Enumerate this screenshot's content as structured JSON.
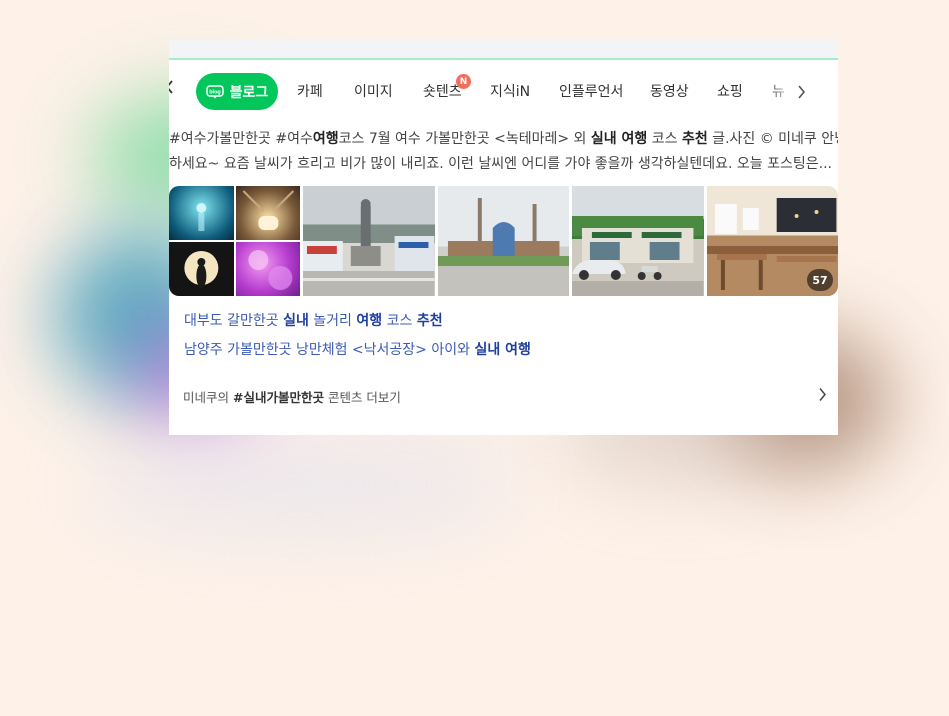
{
  "tabs": {
    "active": "블로그",
    "items": [
      "카페",
      "이미지",
      "숏텐츠",
      "지식iN",
      "인플루언서",
      "동영상",
      "쇼핑",
      "뉴"
    ],
    "new_badge": "N",
    "prev_icon": "chevron-left-icon",
    "next_icon": "chevron-right-icon"
  },
  "snippet": {
    "line1": {
      "a": "#여수가볼만한곳 #여수",
      "b": "여행",
      "c": "코스 7월 여수 가볼만한곳 <녹테마레> 외 ",
      "d": "실내 여행",
      "e": " 코스 ",
      "f": "추천",
      "g": " 글.사진 © 미네쿠 안녕"
    },
    "line2": "하세요~ 요즘 날씨가 흐리고 비가 많이 내리죠. 이런 날씨엔 어디를 가야 좋을까 생각하실텐데요. 오늘 포스팅은..."
  },
  "thumbnails": {
    "count": "57",
    "items": [
      "neon-light-art-collage",
      "lighthouse-statue-street",
      "gate-sculpture-plaza",
      "store-street-with-car",
      "restaurant-interior"
    ]
  },
  "sub_links": [
    {
      "a": "대부도 갈만한곳 ",
      "b": "실내",
      "c": " 놀거리 ",
      "d": "여행",
      "e": " 코스 ",
      "f": "추천"
    },
    {
      "a": "남양주 가볼만한곳 낭만체험 <낙서공장> 아이와 ",
      "b": "실내 여행"
    }
  ],
  "more": {
    "prefix": "미네쿠의 ",
    "tag": "#실내가볼만한곳",
    "suffix": " 콘텐츠 더보기",
    "icon": "chevron-right-icon"
  },
  "colors": {
    "accent": "#03c75a",
    "link": "#3b5bb5",
    "badge": "#f26d5b",
    "background": "#fdf1e8"
  }
}
